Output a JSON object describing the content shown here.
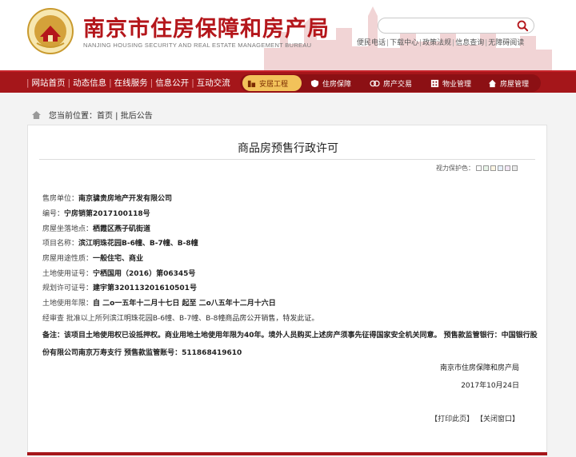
{
  "header": {
    "title": "南京市住房保障和房产局",
    "subtitle": "NANJING HOUSING SECURITY AND REAL ESTATE MANAGEMENT BUREAU",
    "search_placeholder": "",
    "quick_links": [
      "便民电话",
      "下载中心",
      "政策法规",
      "信息查询",
      "无障碍阅读"
    ]
  },
  "nav": {
    "left_items": [
      "网站首页",
      "动态信息",
      "在线服务",
      "信息公开",
      "互动交流"
    ],
    "tabs": [
      {
        "label": "安居工程",
        "icon": "building-icon",
        "active": true
      },
      {
        "label": "住房保障",
        "icon": "shield-icon",
        "active": false
      },
      {
        "label": "房产交易",
        "icon": "exchange-icon",
        "active": false
      },
      {
        "label": "物业管理",
        "icon": "property-icon",
        "active": false
      },
      {
        "label": "房屋管理",
        "icon": "house-icon",
        "active": false
      }
    ]
  },
  "breadcrumb": {
    "prefix": "您当前位置：",
    "path": "首页 | 批后公告"
  },
  "document": {
    "title": "商品房预售行政许可",
    "eye_care_label": "视力保护色：",
    "eye_care_colors": [
      "#ffffff",
      "#e8f4e8",
      "#fdf6e3",
      "#e6f0fb",
      "#f3e6f5",
      "#e9e9e9"
    ],
    "fields": [
      {
        "label": "售房单位：",
        "value": "南京骕贵房地产开发有限公司"
      },
      {
        "label": "编号：",
        "value": "宁房销第2017100118号"
      },
      {
        "label": "房屋坐落地点：",
        "value": "栖霞区燕子矶街道"
      },
      {
        "label": "项目名称：",
        "value": "滨江明珠花园B-6幢、B-7幢、B-8幢"
      },
      {
        "label": "房屋用途性质：",
        "value": "一般住宅、商业"
      },
      {
        "label": "土地使用证号：",
        "value": "宁栖国用（2016）第06345号"
      },
      {
        "label": "规划许可证号：",
        "value": "建宇第320113201610501号"
      },
      {
        "label": "土地使用年限：",
        "value": "自 二o一五年十二月十七日 起至 二o八五年十二月十六日"
      },
      {
        "label": "经审查 批准以上所列",
        "value": "滨江明珠花园B-6幢、B-7幢、B-8幢商品房公开销售，特发此证。"
      }
    ],
    "remark_label": "备注：",
    "remark_text": "该项目土地使用权已设抵押权。商业用地土地使用年限为40年。境外人员购买上述房产须事先征得国家安全机关同意。 预售款监管银行：中国银行股份有限公司南京万寿支行 预售款监管账号：511868419610",
    "issuer": "南京市住房保障和房产局",
    "date": "2017年10月24日",
    "print_label": "【打印此页】",
    "close_label": "【关闭窗口】"
  }
}
